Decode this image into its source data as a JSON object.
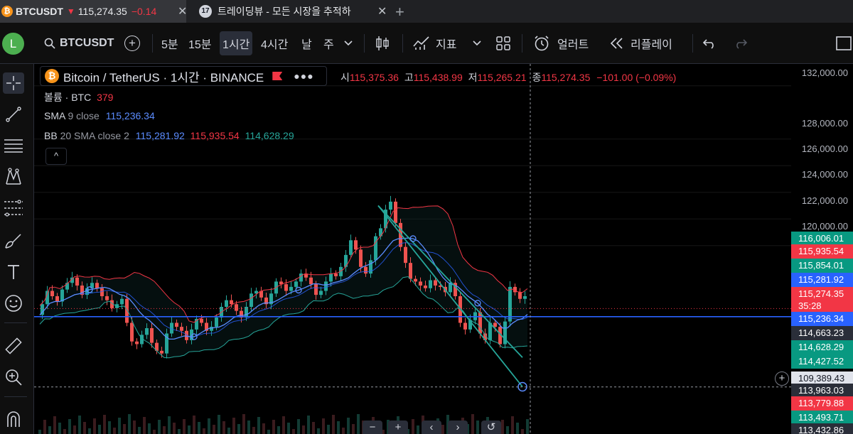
{
  "browser": {
    "tab1": {
      "symbol": "BTCUSDT",
      "arrow": "▼",
      "price": "115,274.35",
      "change": "−0.14"
    },
    "tab2": {
      "badge": "17",
      "title": "트레이딩뷰 - 모든 시장을 추적하"
    },
    "close_glyph": "✕",
    "new_tab": "+"
  },
  "toolbar": {
    "avatar": "L",
    "symbol": "BTCUSDT",
    "add": "+",
    "intervals": [
      "5분",
      "15분",
      "1시간",
      "4시간",
      "날",
      "주"
    ],
    "selected_interval": "1시간",
    "indicators": "지표",
    "alerts": "얼러트",
    "replay": "리플레이"
  },
  "legend": {
    "symbol_title": "Bitcoin / TetherUS · 1시간 · BINANCE",
    "ohlc": {
      "o_label": "시",
      "o": "115,375.36",
      "h_label": "고",
      "h": "115,438.99",
      "l_label": "저",
      "l": "115,265.21",
      "c_label": "종",
      "c": "115,274.35",
      "change": "−101.00 (−0.09%)"
    },
    "volume": {
      "label": "볼륨 · BTC",
      "value": "379"
    },
    "sma": {
      "label": "SMA",
      "params": "9 close",
      "value": "115,236.34"
    },
    "bb": {
      "label": "BB",
      "params": "20 SMA close 2",
      "basis": "115,281.92",
      "upper": "115,935.54",
      "lower": "114,628.29"
    },
    "collapse": "^"
  },
  "price_axis": {
    "ticks": [
      "132,000.00",
      "128,000.00",
      "126,000.00",
      "124,000.00",
      "122,000.00",
      "120,000.00"
    ],
    "labels": [
      {
        "text": "116,006.01",
        "color": "#089981"
      },
      {
        "text": "115,935.54",
        "color": "#f23645"
      },
      {
        "text": "115,854.01",
        "color": "#089981"
      },
      {
        "text": "115,281.92",
        "color": "#2962ff"
      },
      {
        "text": "115,274.35",
        "color": "#f23645"
      },
      {
        "text": "35:28",
        "color": "#f23645"
      },
      {
        "text": "115,236.34",
        "color": "#2962ff"
      },
      {
        "text": "114,663.23",
        "color": "#2a2e39"
      },
      {
        "text": "114,628.29",
        "color": "#089981"
      },
      {
        "text": "114,427.52",
        "color": "#089981"
      },
      {
        "text": "109,389.43",
        "color": "#e0e3eb"
      },
      {
        "text": "113,963.03",
        "color": "#2a2e39"
      },
      {
        "text": "113,779.88",
        "color": "#f23645"
      },
      {
        "text": "113,493.71",
        "color": "#089981"
      },
      {
        "text": "113,432.86",
        "color": "#2a2e39"
      }
    ],
    "crosshair_plus": "+"
  },
  "bottom_nav": [
    "−",
    "+",
    "‹",
    "›",
    "↺"
  ],
  "chart_data": {
    "type": "line",
    "ylim": [
      109000,
      133000
    ],
    "horizontal_line": 114663.23,
    "crosshair_price": 109389.43,
    "close": [
      114800,
      115600,
      116600,
      116200,
      115800,
      116700,
      117200,
      117600,
      117000,
      116300,
      116800,
      117200,
      116800,
      116200,
      115900,
      115300,
      115600,
      116000,
      114200,
      112800,
      112600,
      113300,
      113800,
      112700,
      112100,
      111900,
      113400,
      114200,
      113900,
      113600,
      112900,
      113700,
      114500,
      114200,
      113600,
      113900,
      114600,
      115400,
      115900,
      115600,
      115100,
      114600,
      115400,
      116400,
      116600,
      116100,
      115600,
      116400,
      117300,
      117100,
      116600,
      116900,
      117300,
      117900,
      117600,
      117100,
      116300,
      116600,
      117300,
      117900,
      117700,
      118400,
      119300,
      120400,
      119700,
      118400,
      117900,
      118900,
      120700,
      121300,
      122700,
      123300,
      121700,
      119900,
      118700,
      117500,
      117300,
      117000,
      116800,
      117400,
      117000,
      116900,
      116500,
      117200,
      116200,
      114200,
      113700,
      114400,
      115000,
      113400,
      112900,
      114200,
      113900,
      112600,
      114300,
      116900,
      116500,
      116000,
      116200
    ],
    "series": [
      {
        "name": "SMA 9 close"
      },
      {
        "name": "BB 20 SMA close 2"
      }
    ],
    "trendlines": [
      {
        "from": [
          68,
          123000
        ],
        "to": [
          97,
          111600
        ]
      },
      {
        "from": [
          68,
          123000
        ],
        "to": [
          97,
          109400
        ]
      }
    ]
  }
}
